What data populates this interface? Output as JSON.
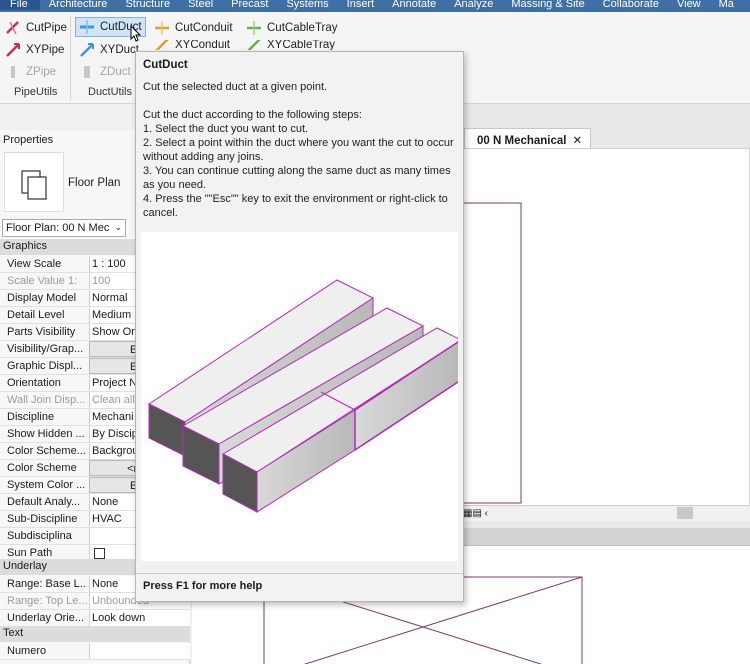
{
  "menu": [
    "File",
    "Architecture",
    "Structure",
    "Steel",
    "Precast",
    "Systems",
    "Insert",
    "Annotate",
    "Analyze",
    "Massing & Site",
    "Collaborate",
    "View",
    "Ma"
  ],
  "ribbon": {
    "pipeutils": {
      "cutpipe": "CutPipe",
      "xypipe": "XYPipe",
      "zpipe": "ZPipe",
      "label": "PipeUtils"
    },
    "ductutils": {
      "cutduct": "CutDuct",
      "xyduct": "XYDuct",
      "zduct": "ZDuct",
      "label": "DuctUtils"
    },
    "conduit": {
      "cutconduit": "CutConduit",
      "xyconduit": "XYConduit"
    },
    "cabletray": {
      "cutcabletray": "CutCableTray",
      "xycabletray": "XYCableTray"
    }
  },
  "tooltip": {
    "title": "CutDuct",
    "summary": "Cut the selected duct at a given point.",
    "intro": "Cut the duct according to the following steps:",
    "steps": [
      "1. Select the duct you want to cut.",
      "2. Select a point within the duct where you want the cut to occur without adding any joins.",
      "3. You can continue cutting along the same duct as many times as you need.",
      "4. Press the \"\"Esc\"\" key to exit the environment or right-click to cancel."
    ],
    "footer": "Press F1 for more help"
  },
  "properties": {
    "title": "Properties",
    "type_name": "Floor Plan",
    "selector": "Floor Plan: 00 N Mec",
    "groups": {
      "graphics": "Graphics",
      "underlay": "Underlay",
      "text": "Text"
    },
    "graphics_rows": [
      {
        "name": "View Scale",
        "value": "1 : 100"
      },
      {
        "name": "Scale Value    1:",
        "value": "100"
      },
      {
        "name": "Display Model",
        "value": "Normal"
      },
      {
        "name": "Detail Level",
        "value": "Medium"
      },
      {
        "name": "Parts Visibility",
        "value": "Show Ori"
      },
      {
        "name": "Visibility/Grap...",
        "value": "Edit"
      },
      {
        "name": "Graphic Displ...",
        "value": "Edit"
      },
      {
        "name": "Orientation",
        "value": "Project N"
      },
      {
        "name": "Wall Join Disp...",
        "value": "Clean all"
      },
      {
        "name": "Discipline",
        "value": "Mechani"
      },
      {
        "name": "Show Hidden ...",
        "value": "By Discip"
      },
      {
        "name": "Color Scheme...",
        "value": "Backgrou"
      },
      {
        "name": "Color Scheme",
        "value": "<non"
      },
      {
        "name": "System Color ...",
        "value": "Edit"
      },
      {
        "name": "Default Analy...",
        "value": "None"
      },
      {
        "name": "Sub-Discipline",
        "value": "HVAC"
      },
      {
        "name": "Subdisciplina",
        "value": ""
      },
      {
        "name": "Sun Path",
        "value": ""
      }
    ],
    "underlay_rows": [
      {
        "name": "Range: Base L...",
        "value": "None"
      },
      {
        "name": "Range: Top Le...",
        "value": "Unbounded"
      },
      {
        "name": "Underlay Orie...",
        "value": "Look down"
      }
    ],
    "text_rows": [
      {
        "name": "Numero",
        "value": ""
      }
    ]
  },
  "view_tab": {
    "label": "00 N Mechanical",
    "close": "✕"
  },
  "colors": {
    "menubar": "#3f6fa5",
    "duct_edge": "#b02ab8",
    "active": "#cfe4f7"
  }
}
